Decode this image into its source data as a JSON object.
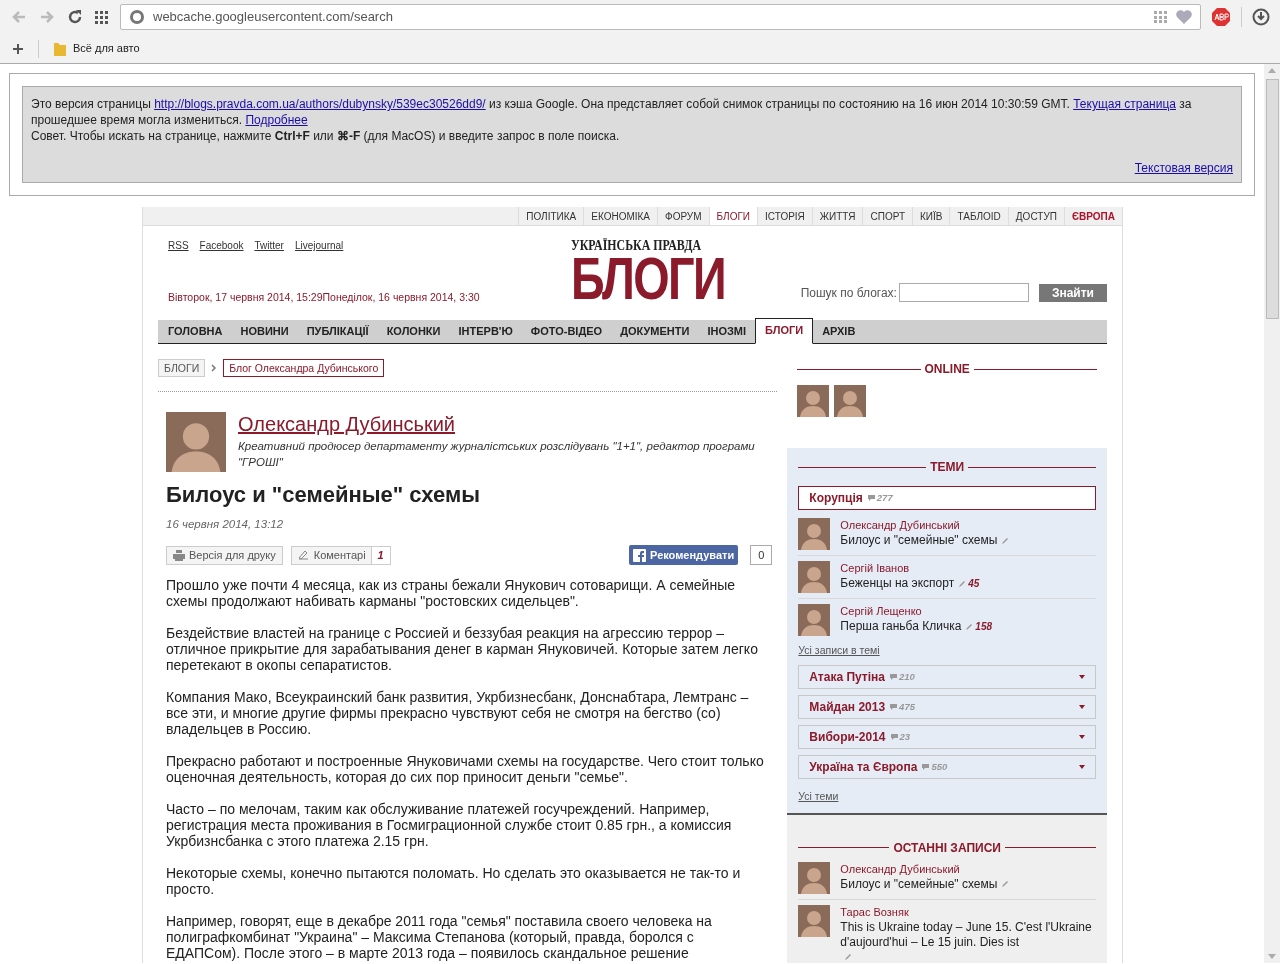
{
  "browser": {
    "url": "webcache.googleusercontent.com/search",
    "bookmarks": [
      {
        "label": "Всё для авто"
      }
    ]
  },
  "cache_notice": {
    "segments": [
      {
        "kind": "text",
        "text": "Это версия страницы "
      },
      {
        "kind": "link",
        "text": "http://blogs.pravda.com.ua/authors/dubynsky/539ec30526dd9/"
      },
      {
        "kind": "text",
        "text": " из кэша Google. Она представляет собой снимок страницы по состоянию на 16 июн 2014 10:30:59 GMT. "
      },
      {
        "kind": "link",
        "text": "Текущая страница"
      },
      {
        "kind": "text",
        "text": " за прошедшее время могла измениться. "
      },
      {
        "kind": "link",
        "text": "Подробнее"
      }
    ],
    "tip": "Совет. Чтобы искать на странице, нажмите **Ctrl+F** или **⌘-F** (для MacOS) и введите запрос в поле поиска.",
    "text_version": "Текстовая версия"
  },
  "site": {
    "sections": [
      {
        "label": "ПОЛІТИКА",
        "selected": false,
        "accent": false
      },
      {
        "label": "ЕКОНОМІКА",
        "selected": false,
        "accent": false
      },
      {
        "label": "ФОРУМ",
        "selected": false,
        "accent": false
      },
      {
        "label": "БЛОГИ",
        "selected": true,
        "accent": false
      },
      {
        "label": "ІСТОРІЯ",
        "selected": false,
        "accent": false
      },
      {
        "label": "ЖИТТЯ",
        "selected": false,
        "accent": false
      },
      {
        "label": "СПОРТ",
        "selected": false,
        "accent": false
      },
      {
        "label": "КИЇВ",
        "selected": false,
        "accent": false
      },
      {
        "label": "ТАБЛОID",
        "selected": false,
        "accent": false
      },
      {
        "label": "ДОСТУП",
        "selected": false,
        "accent": false
      },
      {
        "label": "ЄВРОПА",
        "selected": false,
        "accent": true
      }
    ],
    "social_links": [
      "RSS",
      "Facebook",
      "Twitter",
      "Livejournal"
    ],
    "dates": "Вівторок, 17 червня 2014, 15:29Понеділок, 16 червня 2014, 3:30",
    "logo": {
      "small": "УКРАЇНСЬКА ПРАВДА",
      "big": "БЛОГИ"
    },
    "search": {
      "label": "Пошук по блогах:",
      "button": "Знайти"
    },
    "main_nav": [
      {
        "label": "ГОЛОВНА",
        "selected": false
      },
      {
        "label": "НОВИНИ",
        "selected": false
      },
      {
        "label": "ПУБЛІКАЦІЇ",
        "selected": false
      },
      {
        "label": "КОЛОНКИ",
        "selected": false
      },
      {
        "label": "ІНТЕРВ'Ю",
        "selected": false
      },
      {
        "label": "ФОТО-ВІДЕО",
        "selected": false
      },
      {
        "label": "ДОКУМЕНТИ",
        "selected": false
      },
      {
        "label": "ІНОЗМІ",
        "selected": false
      },
      {
        "label": "БЛОГИ",
        "selected": true
      },
      {
        "label": "АРХІВ",
        "selected": false
      }
    ],
    "breadcrumbs": [
      {
        "label": "БЛОГИ",
        "current": false
      },
      {
        "label": "Блог Олександра Дубинського",
        "current": true
      }
    ]
  },
  "author": {
    "name": "Олександр Дубинський",
    "bio": "Креативний продюсер департаменту журналістських розслідувань \"1+1\", редактор програми \"ГРОШІ\""
  },
  "article": {
    "title": "Билоус и \"семейные\" схемы",
    "date": "16 червня 2014, 13:12",
    "print_button": "Версія для друку",
    "comments_button": "Коментарі",
    "comments_count": "1",
    "like_button": "Рекомендувати",
    "like_count": "0",
    "paragraphs": [
      "Прошло уже почти 4 месяца, как из страны бежали Янукович сотоварищи. А семейные схемы продолжают набивать карманы \"ростовских сидельцев\".",
      "Бездействие властей на границе с Россией и беззубая реакция на агрессию террор – отличное прикрытие для зарабатывания денег в карман Януковичей. Которые затем легко перетекают в окопы сепаратистов.",
      "Компания Мако, Всеукраинский банк развития, Укрбизнесбанк, Донснабтара, Лемтранс – все эти, и многие другие фирмы прекрасно чувствуют себя не смотря на бегство (со) владельцев в Россию.",
      "Прекрасно работают и построенные Януковичами схемы на государстве. Чего стоит только оценочная деятельность, которая до сих пор приносит деньги \"семье\".",
      "Часто – по мелочам, таким как обслуживание платежей госучреждений. Например, регистрация места проживания в Госмиграционной службе стоит 0.85 грн., а комиссия Укрбизнсбанка с этого платежа 2.15 грн.",
      "Некоторые схемы, конечно пытаются поломать. Но сделать это оказывается не так-то и просто.",
      "Например, говорят, еще в декабре 2011 года \"семья\" поставила своего человека на полиграфкомбинат \"Украина\" – Максима Степанова (который, правда, боролся с ЕДАПСом). После этого – в марте 2013 года – появилось скандальное решение"
    ]
  },
  "sidebar": {
    "online": {
      "title": "ONLINE"
    },
    "topics": {
      "title": "ТЕМИ",
      "items": [
        {
          "name": "Корупція",
          "count": "277",
          "expanded": true,
          "posts": [
            {
              "author": "Олександр Дубинський",
              "title": "Билоус и \"семейные\" схемы"
            },
            {
              "author": "Сергій Іванов",
              "title": "Беженцы на экспорт",
              "count": "45"
            },
            {
              "author": "Сергій Лещенко",
              "title": "Перша ганьба Кличка",
              "count": "158"
            }
          ],
          "all_link": "Усі записи в темі"
        },
        {
          "name": "Атака Путіна",
          "count": "210",
          "expanded": false
        },
        {
          "name": "Майдан 2013",
          "count": "475",
          "expanded": false
        },
        {
          "name": "Вибори-2014",
          "count": "23",
          "expanded": false
        },
        {
          "name": "Україна та Європа",
          "count": "550",
          "expanded": false
        }
      ],
      "all_link": "Усі теми"
    },
    "latest": {
      "title": "ОСТАННІ ЗАПИСИ",
      "posts": [
        {
          "author": "Олександр Дубинський",
          "title": "Билоус и \"семейные\" схемы"
        },
        {
          "author": "Тарас Возняк",
          "title": "This is Ukraine today – June 15. C'est l'Ukraine d'aujourd'hui – Le 15 juin. Dies ist"
        }
      ]
    }
  }
}
